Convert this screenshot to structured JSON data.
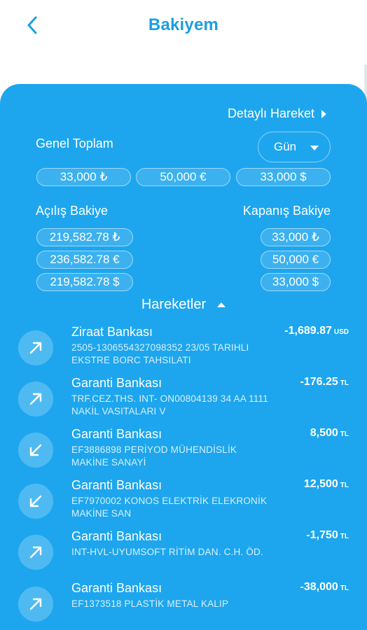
{
  "header": {
    "title": "Bakiyem"
  },
  "panel": {
    "detail_link": "Detaylı Hareket",
    "total_label": "Genel Toplam",
    "period": "Gün",
    "totals": [
      "33,000 ₺",
      "50,000 €",
      "33,000 $"
    ],
    "opening_label": "Açılış Bakiye",
    "closing_label": "Kapanış Bakiye",
    "opening": [
      "219,582.78 ₺",
      "236,582.78 €",
      "219,582.78 $"
    ],
    "closing": [
      "33,000 ₺",
      "50,000 €",
      "33,000 $"
    ],
    "moves_label": "Hareketler"
  },
  "transactions": [
    {
      "bank": "Ziraat Bankası",
      "desc": "2505-1306554327098352 23/05 TARIHLI EKSTRE BORC TAHSILATI",
      "amount": "-1,689.87",
      "currency": "USD",
      "direction": "out"
    },
    {
      "bank": "Garanti Bankası",
      "desc": "TRF.CEZ.THS. INT- ON00804139 34 AA 1111 NAKİL VASITALARI V",
      "amount": "-176.25",
      "currency": "TL",
      "direction": "out"
    },
    {
      "bank": "Garanti Bankası",
      "desc": "EF3886898 PERİYOD MÜHENDİSLİK MAKİNE SANAYİ",
      "amount": "8,500",
      "currency": "TL",
      "direction": "in"
    },
    {
      "bank": "Garanti Bankası",
      "desc": "EF7970002 KONOS ELEKTRİK ELEKRONİK MAKİNE SAN",
      "amount": "12,500",
      "currency": "TL",
      "direction": "in"
    },
    {
      "bank": "Garanti Bankası",
      "desc": "INT-HVL-UYUMSOFT RİTİM DAN. C.H. ÖD.",
      "amount": "-1,750",
      "currency": "TL",
      "direction": "out"
    },
    {
      "bank": "Garanti Bankası",
      "desc": "EF1373518 PLASTİK METAL KALIP",
      "amount": "-38,000",
      "currency": "TL",
      "direction": "out"
    }
  ]
}
